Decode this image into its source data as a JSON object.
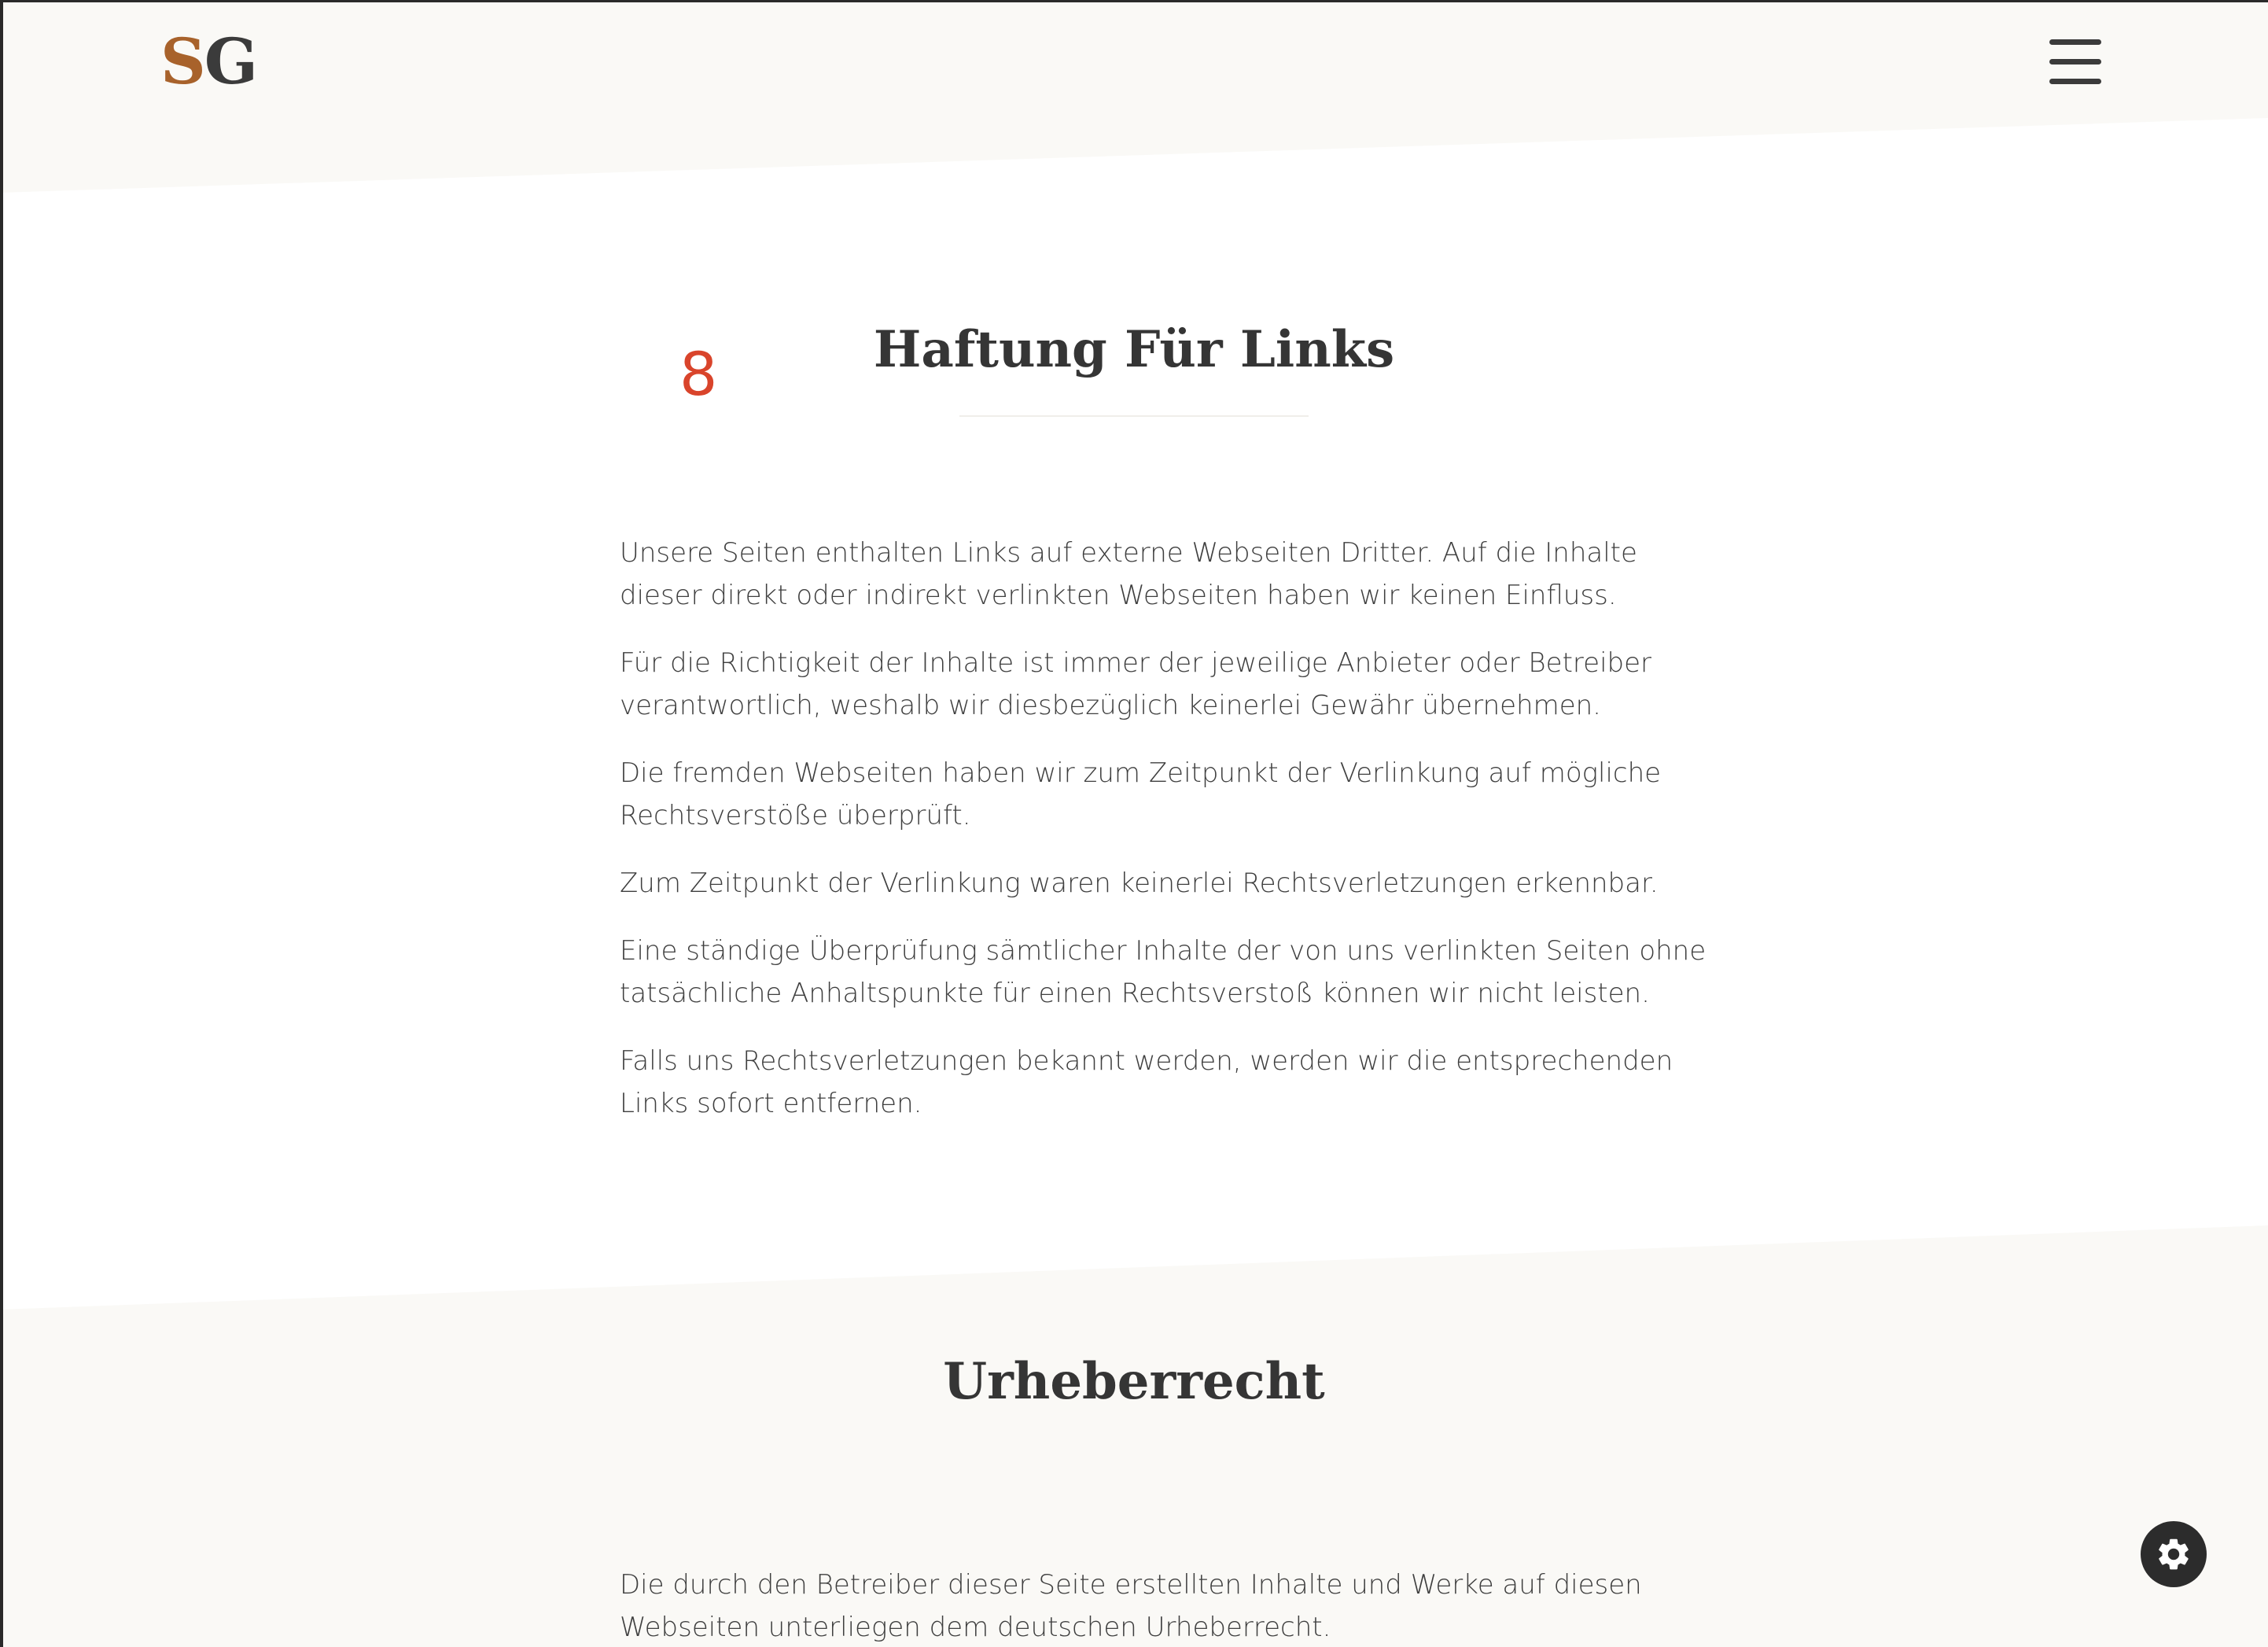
{
  "logo": {
    "s": "S",
    "g": "G"
  },
  "section1": {
    "number": "8",
    "title": "Haftung Für Links",
    "paragraphs": [
      "Unsere Seiten enthalten Links auf externe Webseiten Dritter. Auf die Inhalte dieser direkt oder indirekt verlinkten Webseiten haben wir keinen Einfluss.",
      "Für die Richtigkeit der Inhalte ist immer der jeweilige Anbieter oder Betreiber verantwortlich, weshalb wir diesbezüglich keinerlei Gewähr übernehmen.",
      "Die fremden Webseiten haben wir zum Zeitpunkt der Verlinkung auf mögliche Rechtsverstöße überprüft.",
      "Zum Zeitpunkt der Verlinkung waren keinerlei Rechtsverletzungen erkennbar.",
      "Eine ständige Überprüfung sämtlicher Inhalte der von uns verlinkten Seiten ohne tatsächliche Anhaltspunkte für einen Rechtsverstoß können wir nicht leisten.",
      "Falls uns Rechtsverletzungen bekannt werden, werden wir die entsprechenden Links sofort entfernen."
    ]
  },
  "section2": {
    "title": "Urheberrecht",
    "paragraphs": [
      "Die durch den Betreiber dieser Seite erstellten Inhalte und Werke auf diesen Webseiten unterliegen dem deutschen Urheberrecht."
    ]
  },
  "colors": {
    "accent_number": "#d9442b",
    "logo_s": "#a8622b",
    "band_bg": "#faf9f6",
    "text": "#3f3f3f"
  },
  "icons": {
    "menu": "hamburger-menu-icon",
    "settings": "gear-icon"
  }
}
